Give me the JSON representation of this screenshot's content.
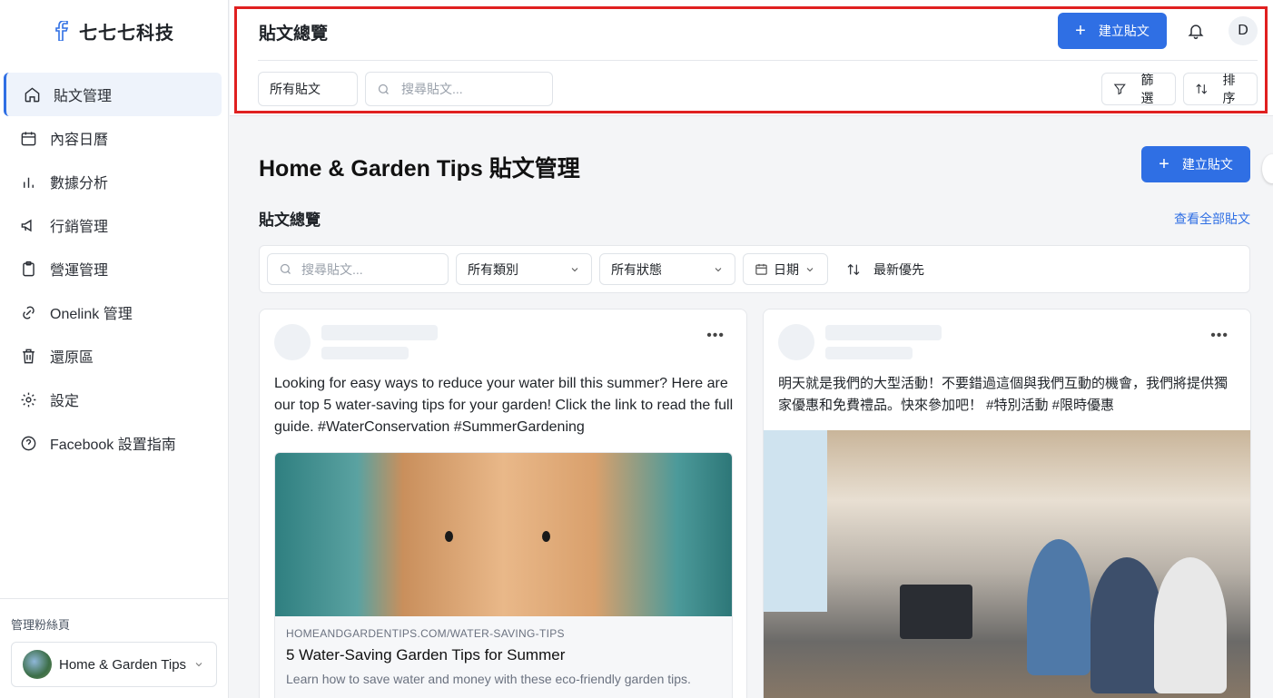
{
  "brand": {
    "name": "七七七科技",
    "logo_icon": "facebook-icon"
  },
  "sidebar": {
    "items": [
      {
        "label": "貼文管理",
        "icon": "home-icon",
        "active": true
      },
      {
        "label": "內容日曆",
        "icon": "calendar-icon"
      },
      {
        "label": "數據分析",
        "icon": "bar-chart-icon"
      },
      {
        "label": "行銷管理",
        "icon": "megaphone-icon"
      },
      {
        "label": "營運管理",
        "icon": "clipboard-icon"
      },
      {
        "label": "Onelink 管理",
        "icon": "link-icon"
      },
      {
        "label": "還原區",
        "icon": "trash-icon"
      },
      {
        "label": "設定",
        "icon": "gear-icon"
      },
      {
        "label": "Facebook 設置指南",
        "icon": "help-circle-icon"
      }
    ],
    "manage_label": "管理粉絲頁",
    "page_name": "Home & Garden Tips"
  },
  "header": {
    "title": "貼文總覽",
    "create_label": "建立貼文",
    "user_initial": "D",
    "all_posts": "所有貼文",
    "search_placeholder": "搜尋貼文...",
    "filter_label": "篩選",
    "sort_label": "排序"
  },
  "main": {
    "title": "Home & Garden Tips 貼文管理",
    "create_label": "建立貼文",
    "section_title": "貼文總覽",
    "view_all": "查看全部貼文",
    "filters": {
      "search_placeholder": "搜尋貼文...",
      "category": "所有類別",
      "status": "所有狀態",
      "date": "日期",
      "sort": "最新優先"
    }
  },
  "posts": [
    {
      "text": "Looking for easy ways to reduce your water bill this summer? Here are our top 5 water-saving tips for your garden! Click the link to read the full guide. #WaterConservation #SummerGardening",
      "link": {
        "domain": "HOMEANDGARDENTIPS.COM/WATER-SAVING-TIPS",
        "title": "5 Water-Saving Garden Tips for Summer",
        "description": "Learn how to save water and money with these eco-friendly garden tips."
      }
    },
    {
      "text": "明天就是我們的大型活動！不要錯過這個與我們互動的機會，我們將提供獨家優惠和免費禮品。快來參加吧！ #特別活動 #限時優惠"
    }
  ],
  "colors": {
    "accent": "#2f6fe4",
    "highlight_frame": "#e02020"
  }
}
